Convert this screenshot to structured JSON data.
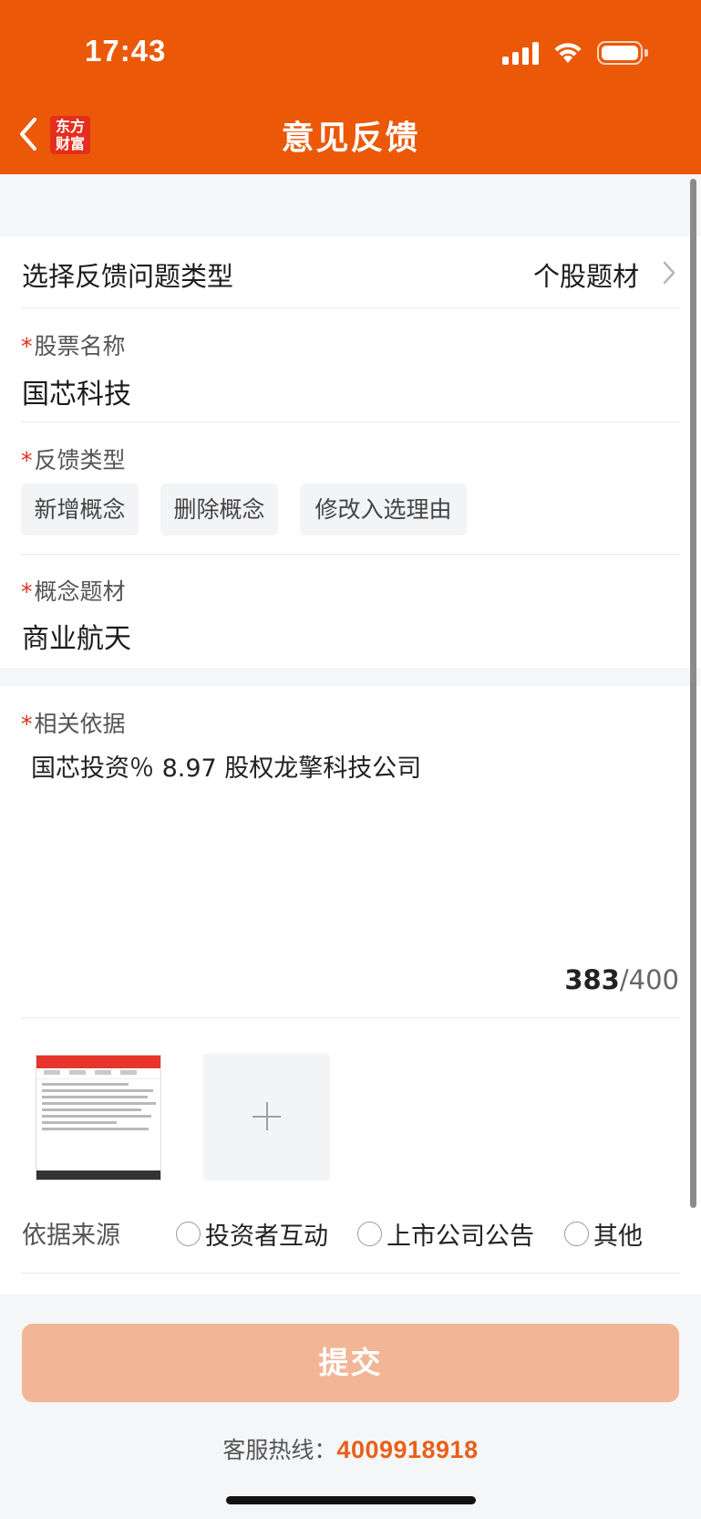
{
  "status_bar": {
    "time": "17:43"
  },
  "nav": {
    "title": "意见反馈",
    "logo_line1": "东方",
    "logo_line2": "财富"
  },
  "type_row": {
    "label": "选择反馈问题类型",
    "value": "个股题材"
  },
  "stock": {
    "label": "股票名称",
    "value": "国芯科技"
  },
  "feedback_type": {
    "label": "反馈类型",
    "options": [
      "新增概念",
      "删除概念",
      "修改入选理由"
    ]
  },
  "concept": {
    "label": "概念题材",
    "value": "商业航天"
  },
  "evidence": {
    "label": "相关依据",
    "text": "国芯投资％ 8.97 股权龙擎科技公司",
    "count": "383",
    "max": "/400"
  },
  "source": {
    "label": "依据来源",
    "options": [
      "投资者互动",
      "上市公司公告",
      "其他"
    ]
  },
  "required_mark": "*",
  "submit_label": "提交",
  "hotline": {
    "label": "客服热线：",
    "number": "4009918918"
  },
  "colors": {
    "brand": "#eb5808",
    "required": "#e0301e",
    "submit_disabled": "#f2b596",
    "hotline": "#e8601c"
  },
  "icons": [
    "back-arrow-icon",
    "chevron-right-icon",
    "add-image-icon",
    "signal-icon",
    "wifi-icon",
    "battery-icon"
  ]
}
